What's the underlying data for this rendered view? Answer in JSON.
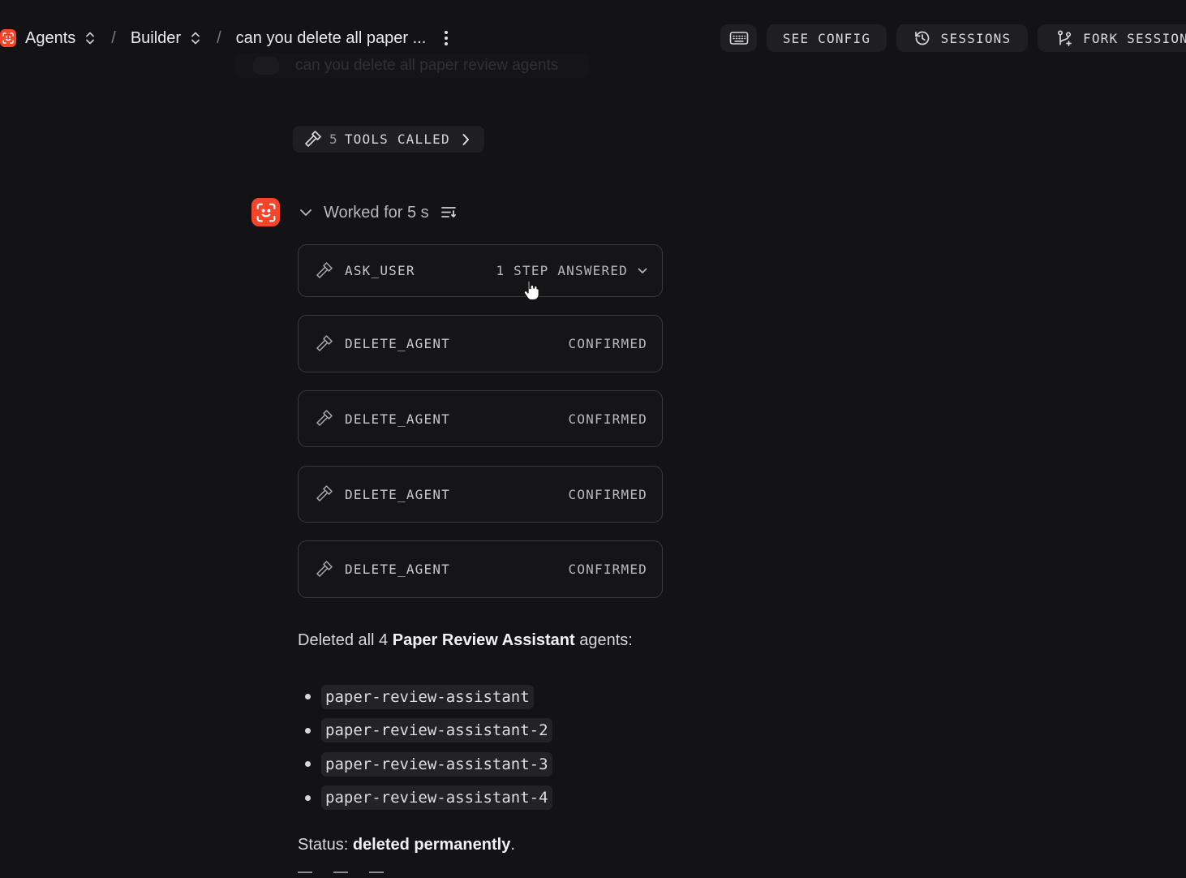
{
  "header": {
    "breadcrumbs": [
      {
        "label": "Agents"
      },
      {
        "label": "Builder"
      }
    ],
    "separator": "/",
    "session_title": "can you delete all paper ...",
    "buttons": {
      "see_config": "SEE CONFIG",
      "sessions": "SESSIONS",
      "fork_session": "FORK SESSION"
    }
  },
  "ghost_message": {
    "text": "can you delete all paper review agents"
  },
  "tools_called": {
    "count": "5",
    "label": "TOOLS CALLED"
  },
  "worked": {
    "label": "Worked for 5 s"
  },
  "tool_calls": [
    {
      "name": "ASK_USER",
      "status": "1 STEP ANSWERED"
    },
    {
      "name": "DELETE_AGENT",
      "status": "CONFIRMED"
    },
    {
      "name": "DELETE_AGENT",
      "status": "CONFIRMED"
    },
    {
      "name": "DELETE_AGENT",
      "status": "CONFIRMED"
    },
    {
      "name": "DELETE_AGENT",
      "status": "CONFIRMED"
    }
  ],
  "response": {
    "summary_prefix": "Deleted all 4 ",
    "summary_bold": "Paper Review Assistant",
    "summary_suffix": " agents:",
    "deleted_agents": [
      "paper-review-assistant",
      "paper-review-assistant-2",
      "paper-review-assistant-3",
      "paper-review-assistant-4"
    ],
    "status_prefix": "Status: ",
    "status_bold": "deleted permanently",
    "status_suffix": "."
  },
  "colors": {
    "background": "#131315",
    "brand": "#f4442a",
    "card_border": "#3a3a3e",
    "pill_bg": "#1f1f22"
  },
  "icons": {
    "brand": "agent-logo-icon",
    "updown": "chevron-updown-icon",
    "more": "kebab-menu-icon",
    "keyboard": "keyboard-icon",
    "history": "history-icon",
    "fork": "git-fork-icon",
    "tool": "hammer-icon",
    "expand": "chevron-right-icon",
    "collapse": "chevron-down-icon",
    "wrap": "text-wrap-icon"
  }
}
